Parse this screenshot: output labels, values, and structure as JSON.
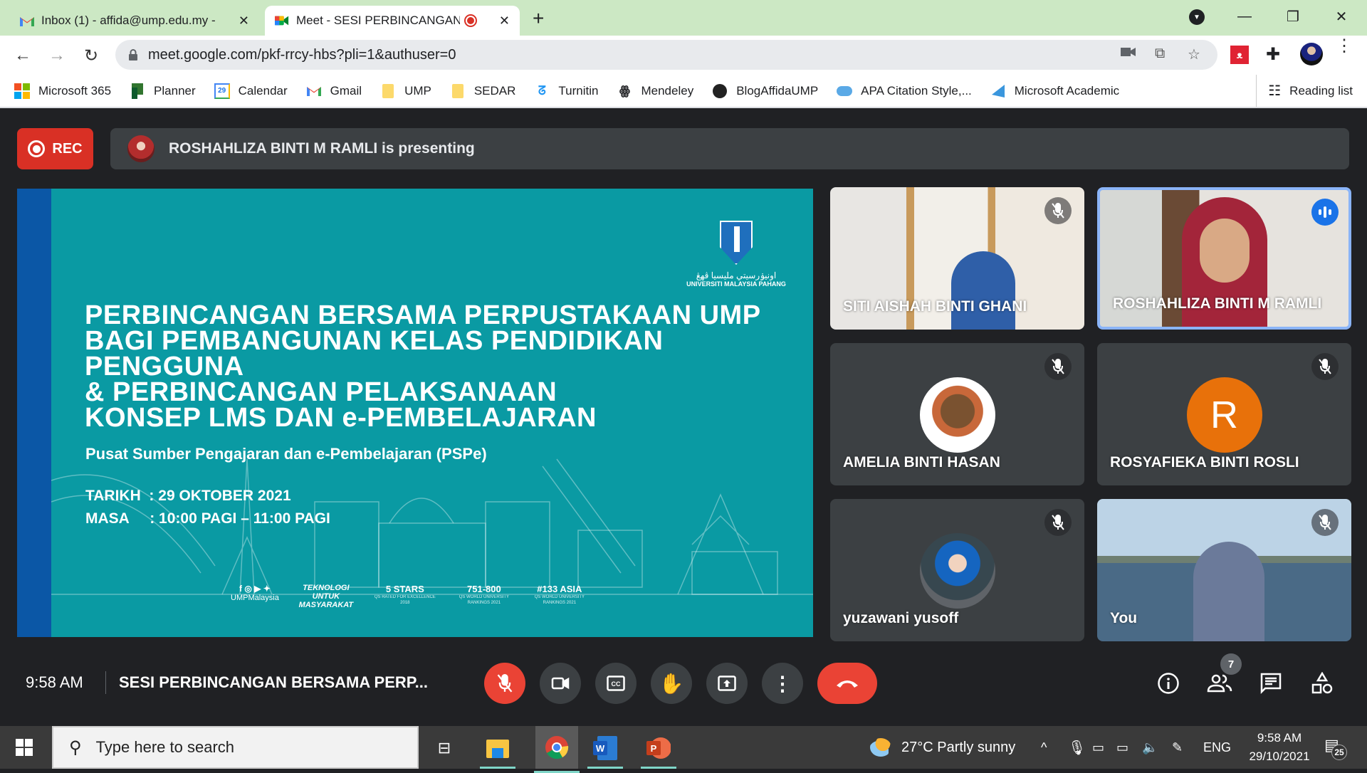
{
  "browser": {
    "tabs": [
      {
        "title": "Inbox (1) - affida@ump.edu.my -",
        "icon": "gmail-icon",
        "active": false
      },
      {
        "title": "Meet - SESI PERBINCANGAN",
        "icon": "meet-icon",
        "active": true,
        "recording": true
      }
    ],
    "new_tab": "+",
    "url": "meet.google.com/pkf-rrcy-hbs?pli=1&authuser=0",
    "bookmarks": [
      {
        "label": "Microsoft 365",
        "icon": "microsoft-icon"
      },
      {
        "label": "Planner",
        "icon": "planner-icon"
      },
      {
        "label": "Calendar",
        "icon": "calendar-icon"
      },
      {
        "label": "Gmail",
        "icon": "gmail-icon"
      },
      {
        "label": "UMP",
        "icon": "folder-icon"
      },
      {
        "label": "SEDAR",
        "icon": "folder-icon"
      },
      {
        "label": "Turnitin",
        "icon": "turnitin-icon"
      },
      {
        "label": "Mendeley",
        "icon": "mendeley-icon"
      },
      {
        "label": "BlogAffidaUMP",
        "icon": "globe-icon"
      },
      {
        "label": "APA Citation Style,...",
        "icon": "cloud-icon"
      },
      {
        "label": "Microsoft Academic",
        "icon": "academic-icon"
      }
    ],
    "reading_list": "Reading list",
    "calendar_day": "29"
  },
  "meet": {
    "rec_label": "REC",
    "presenting": "ROSHAHLIZA BINTI M RAMLI is presenting",
    "slide": {
      "title": "PERBINCANGAN BERSAMA PERPUSTAKAAN UMP\nBAGI PEMBANGUNAN KELAS PENDIDIKAN\nPENGGUNA\n& PERBINCANGAN PELAKSANAAN\nKONSEP LMS DAN e-PEMBELAJARAN",
      "subtitle": "Pusat Sumber Pengajaran dan e-Pembelajaran (PSPe)",
      "date_line": "TARIKH  : 29 OKTOBER 2021",
      "time_line": "MASA     : 10:00 PAGI – 11:00 PAGI",
      "logo_arabic": "اونيۏرسيتي مليسيا ڤهڠ",
      "logo_name": "UNIVERSITI MALAYSIA PAHANG",
      "social_handle": "UMPMalaysia",
      "tagline": "TEKNOLOGI UNTUK MASYARAKAT",
      "badges": [
        {
          "big": "5 STARS",
          "small": "QS RATED FOR EXCELLENCE 2018"
        },
        {
          "big": "751-800",
          "small": "QS WORLD UNIVERSITY RANKINGS 2021"
        },
        {
          "big": "#133 ASIA",
          "small": "QS WORLD UNIVERSITY RANKINGS 2021"
        }
      ]
    },
    "participants": [
      {
        "name": "SITI AISHAH BINTI GHANI",
        "muted": true,
        "video": true
      },
      {
        "name": "ROSHAHLIZA BINTI M RAMLI",
        "muted": false,
        "speaking": true,
        "video": true
      },
      {
        "name": "AMELIA BINTI HASAN",
        "muted": true,
        "video": false
      },
      {
        "name": "ROSYAFIEKA BINTI ROSLI",
        "muted": true,
        "video": false,
        "initial": "R",
        "avatar_color": "#e8710a"
      },
      {
        "name": "yuzawani yusoff",
        "muted": true,
        "video": false
      },
      {
        "name": "You",
        "muted": true,
        "video": true
      }
    ],
    "clock": "9:58 AM",
    "meeting_title": "SESI PERBINCANGAN BERSAMA PERP...",
    "participant_count": "7",
    "colors": {
      "danger": "#ea4335",
      "surface": "#3c4043",
      "background": "#202124",
      "slide": "#0a9aa3",
      "speaking": "#1a73e8"
    }
  },
  "taskbar": {
    "search_placeholder": "Type here to search",
    "weather": "27°C  Partly sunny",
    "language": "ENG",
    "time": "9:58 AM",
    "date": "29/10/2021",
    "notifications": "25"
  }
}
